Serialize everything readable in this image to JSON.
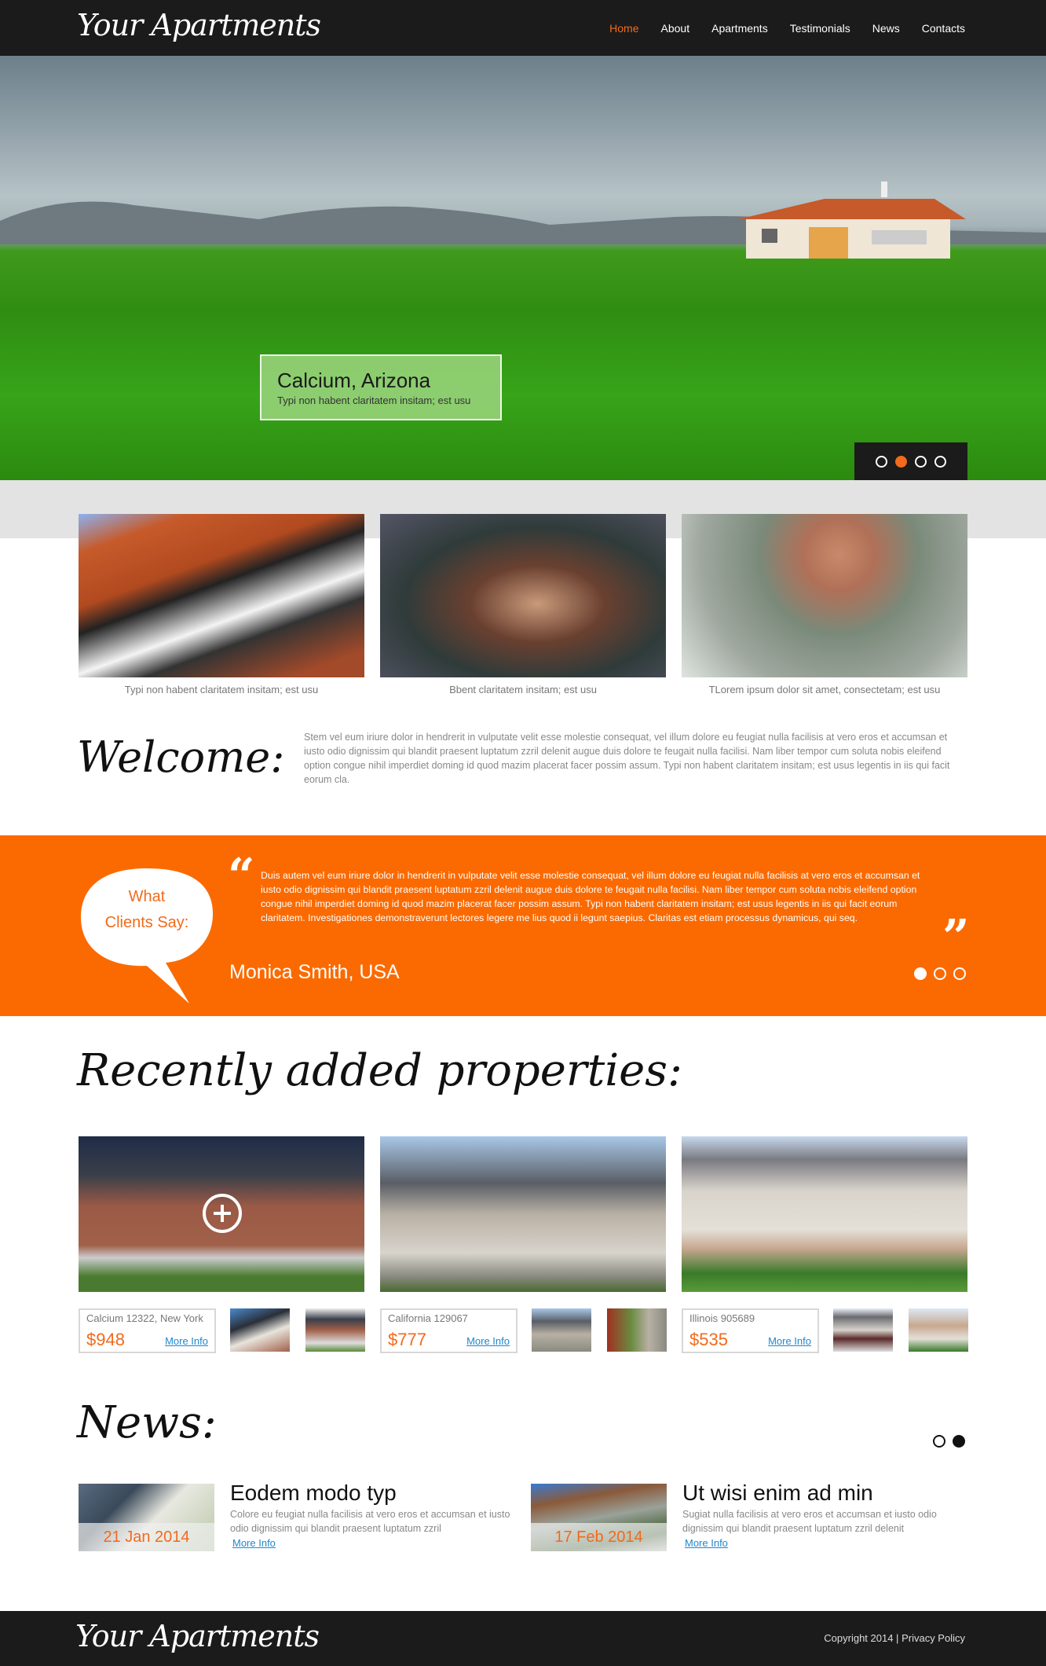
{
  "header": {
    "logo": "Your Apartments",
    "nav": [
      {
        "label": "Home",
        "active": true
      },
      {
        "label": "About",
        "active": false
      },
      {
        "label": "Apartments",
        "active": false
      },
      {
        "label": "Testimonials",
        "active": false
      },
      {
        "label": "News",
        "active": false
      },
      {
        "label": "Contacts",
        "active": false
      }
    ]
  },
  "hero": {
    "caption_title": "Calcium, Arizona",
    "caption_sub": "Typi non habent claritatem insitam; est usu",
    "slides": 4,
    "active_slide": 2
  },
  "features": [
    {
      "caption": "Typi non habent claritatem insitam; est usu",
      "image": "roof-windows-photo"
    },
    {
      "caption": "Bbent claritatem insitam; est usu",
      "image": "handshake-photo"
    },
    {
      "caption": "TLorem ipsum dolor sit amet, consectetam; est usu",
      "image": "keys-photo"
    }
  ],
  "welcome": {
    "title": "Welcome:",
    "text": "Stem vel eum iriure dolor in hendrerit in vulputate velit esse molestie consequat, vel illum dolore eu feugiat nulla facilisis at vero eros et accumsan et iusto odio dignissim qui blandit praesent luptatum zzril delenit augue duis dolore te feugait nulla facilisi. Nam liber tempor cum soluta nobis eleifend option congue nihil imperdiet doming id quod mazim placerat facer possim assum. Typi non habent claritatem insitam; est usus legentis in iis qui facit eorum cla."
  },
  "testimonials": {
    "bubble_line1": "What",
    "bubble_line2": "Clients Say:",
    "quote_open": "“",
    "quote_close": "”",
    "text": "Duis autem vel eum iriure dolor in hendrerit in vulputate velit esse molestie consequat, vel illum dolore eu feugiat nulla facilisis at vero eros et accumsan et iusto odio dignissim qui blandit praesent luptatum zzril delenit augue duis dolore te feugait nulla facilisi. Nam liber tempor cum soluta nobis eleifend option congue nihil imperdiet doming id quod mazim placerat facer possim assum. Typi non habent claritatem insitam; est usus legentis in iis qui facit eorum claritatem. Investigationes demonstraverunt lectores legere me lius quod ii legunt saepius. Claritas est etiam processus dynamicus, qui seq.",
    "author": "Monica Smith, USA",
    "slides": 3,
    "active_slide": 1
  },
  "properties": {
    "title": "Recently added properties:",
    "items": [
      {
        "address": "Calcium 12322, New York",
        "price": "$948",
        "more": "More Info"
      },
      {
        "address": "California 129067",
        "price": "$777",
        "more": "More Info"
      },
      {
        "address": "Illinois 905689",
        "price": "$535",
        "more": "More Info"
      }
    ]
  },
  "news": {
    "title": "News:",
    "slides": 2,
    "active_slide": 2,
    "items": [
      {
        "date": "21 Jan 2014",
        "headline": "Eodem modo typ",
        "text": "Colore eu feugiat nulla facilisis at vero eros et accumsan et iusto odio dignissim qui blandit praesent luptatum zzril",
        "more": "More Info"
      },
      {
        "date": "17 Feb 2014",
        "headline": "Ut wisi enim ad min",
        "text": "Sugiat nulla facilisis at vero eros et accumsan et iusto odio dignissim qui blandit praesent luptatum zzril delenit",
        "more": "More Info"
      }
    ]
  },
  "footer": {
    "logo": "Your Apartments",
    "copyright": "Copyright 2014 |",
    "privacy": "Privacy Policy"
  },
  "colors": {
    "accent": "#f26a1b",
    "orange_band": "#fb6a00",
    "header_bg": "#1b1b1b",
    "link": "#1e88d0"
  }
}
